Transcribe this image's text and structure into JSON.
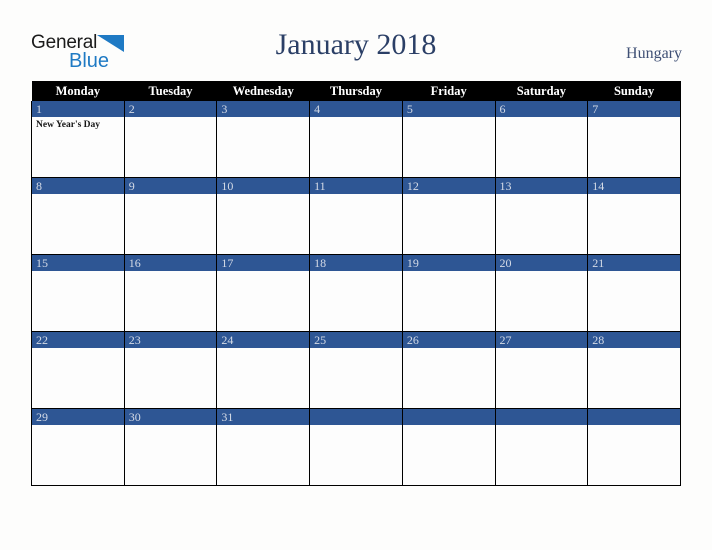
{
  "brand": {
    "word_one": "General",
    "word_two": "Blue",
    "triangle_color": "#1f7ac4",
    "word_one_color": "#1b1b1b"
  },
  "header": {
    "title": "January 2018",
    "country": "Hungary",
    "title_color": "#2b3f66",
    "country_color": "#3f5075"
  },
  "calendar": {
    "weekday_headers": [
      "Monday",
      "Tuesday",
      "Wednesday",
      "Thursday",
      "Friday",
      "Saturday",
      "Sunday"
    ],
    "header_background": "#000000",
    "header_text_color": "#ffffff",
    "date_bar_color": "#2e5694",
    "date_text_color": "#d4dae6",
    "cell_background": "#fdfdfd",
    "grid_line_color": "#000000",
    "weeks": [
      [
        {
          "date": "1",
          "holidays": [
            "New Year's Day"
          ]
        },
        {
          "date": "2",
          "holidays": []
        },
        {
          "date": "3",
          "holidays": []
        },
        {
          "date": "4",
          "holidays": []
        },
        {
          "date": "5",
          "holidays": []
        },
        {
          "date": "6",
          "holidays": []
        },
        {
          "date": "7",
          "holidays": []
        }
      ],
      [
        {
          "date": "8",
          "holidays": []
        },
        {
          "date": "9",
          "holidays": []
        },
        {
          "date": "10",
          "holidays": []
        },
        {
          "date": "11",
          "holidays": []
        },
        {
          "date": "12",
          "holidays": []
        },
        {
          "date": "13",
          "holidays": []
        },
        {
          "date": "14",
          "holidays": []
        }
      ],
      [
        {
          "date": "15",
          "holidays": []
        },
        {
          "date": "16",
          "holidays": []
        },
        {
          "date": "17",
          "holidays": []
        },
        {
          "date": "18",
          "holidays": []
        },
        {
          "date": "19",
          "holidays": []
        },
        {
          "date": "20",
          "holidays": []
        },
        {
          "date": "21",
          "holidays": []
        }
      ],
      [
        {
          "date": "22",
          "holidays": []
        },
        {
          "date": "23",
          "holidays": []
        },
        {
          "date": "24",
          "holidays": []
        },
        {
          "date": "25",
          "holidays": []
        },
        {
          "date": "26",
          "holidays": []
        },
        {
          "date": "27",
          "holidays": []
        },
        {
          "date": "28",
          "holidays": []
        }
      ],
      [
        {
          "date": "29",
          "holidays": []
        },
        {
          "date": "30",
          "holidays": []
        },
        {
          "date": "31",
          "holidays": []
        },
        {
          "date": "",
          "holidays": []
        },
        {
          "date": "",
          "holidays": []
        },
        {
          "date": "",
          "holidays": []
        },
        {
          "date": "",
          "holidays": []
        }
      ]
    ]
  }
}
